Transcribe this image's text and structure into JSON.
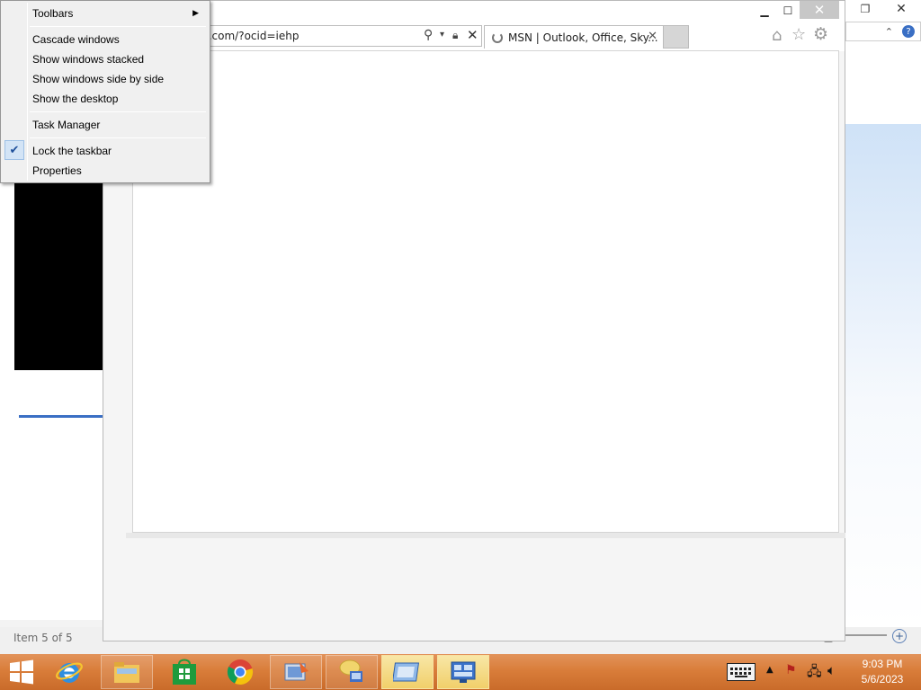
{
  "context_menu": {
    "items": [
      {
        "label": "Toolbars",
        "has_submenu": true
      },
      {
        "label": "Cascade windows"
      },
      {
        "label": "Show windows stacked"
      },
      {
        "label": "Show windows side by side"
      },
      {
        "label": "Show the desktop"
      },
      {
        "label": "Task Manager"
      },
      {
        "label": "Lock the taskbar",
        "checked": true
      },
      {
        "label": "Properties"
      }
    ]
  },
  "browser": {
    "address": "https://www.msn.com/?ocid=iehp",
    "tab_title": "MSN | Outlook, Office, Sky...",
    "icons": [
      "search-icon",
      "lock-icon",
      "stop-icon",
      "home-icon",
      "favorites-star-icon",
      "settings-gear-icon"
    ]
  },
  "background_window": {
    "status_text": "Item 5 of 5"
  },
  "taskbar": {
    "pinned": [
      "start-button",
      "internet-explorer",
      "file-explorer",
      "windows-store",
      "chrome",
      "media-app",
      "chat-app",
      "window-app",
      "remote-desktop"
    ],
    "clock": {
      "time": "9:03 PM",
      "date": "5/6/2023"
    },
    "accent_color": "#d97d3a"
  }
}
